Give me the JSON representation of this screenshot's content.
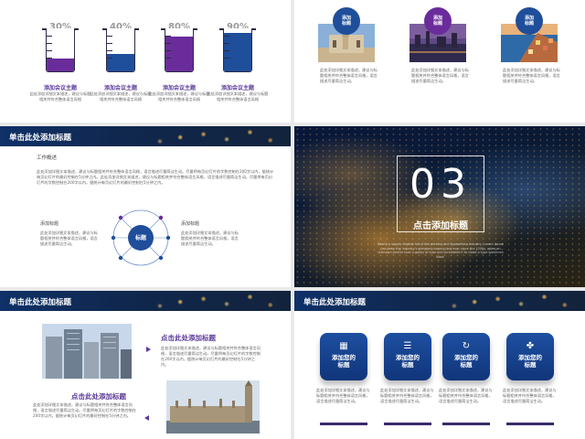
{
  "colors": {
    "navy": "#10357a",
    "purple": "#6a2c9a",
    "blue": "#1f4e9a",
    "accent": "#5b3a9a"
  },
  "slide1": {
    "beakers": [
      {
        "pct": "30%",
        "level": 0.3,
        "color": "#6a2c9a",
        "title": "添加会议主题",
        "desc": "此处添加详细文本描述，建议与标题相关并符合整体语言风格"
      },
      {
        "pct": "40%",
        "level": 0.4,
        "color": "#1f4e9a",
        "title": "添加会议主题",
        "desc": "此处添加详细文本描述，建议与标题相关并符合整体语言风格"
      },
      {
        "pct": "80%",
        "level": 0.8,
        "color": "#6a2c9a",
        "title": "添加会议主题",
        "desc": "此处添加详细文本描述，建议与标题相关并符合整体语言风格"
      },
      {
        "pct": "90%",
        "level": 0.9,
        "color": "#1f4e9a",
        "title": "添加会议主题",
        "desc": "此处添加详细文本描述，建议与标题相关并符合整体语言风格"
      }
    ]
  },
  "slide2": {
    "items": [
      {
        "label": "添加\n标题",
        "color": "#1f4e9a",
        "desc": "此处添加详细文本描述，建议与标题相关并符合整体语言风格，语言描述尽量简洁生动。"
      },
      {
        "label": "添加\n标题",
        "color": "#6a2c9a",
        "desc": "此处添加详细文本描述，建议与标题相关并符合整体语言风格，语言描述尽量简洁生动。"
      },
      {
        "label": "添加\n标题",
        "color": "#1f4e9a",
        "desc": "此处添加详细文本描述，建议与标题相关并符合整体语言风格，语言描述尽量简洁生动。"
      }
    ]
  },
  "slide3": {
    "title": "单击此处添加标题",
    "subtitle": "工作概述",
    "body": "此处添加详细文本描述，建议与标题相关并符合整体语言风格，语言描述尽量简洁生动。尽量将每页幻灯片的字数控制在200字以内，据统计每页幻灯片的最好控制在5分钟之内。此处添加详细文本描述，建议与标题相关并符合整体语言风格，语言描述尽量简洁生动。尽量将每页幻灯片的字数控制在200字以内，据统计每页幻灯片的最好控制在5分钟之内。",
    "left_label": "添加标题",
    "left_desc": "此处添加详细文本描述，建议与标题相关并符合整体语言风格，语言描述尽量简洁生动。",
    "right_label": "添加标题",
    "right_desc": "此处添加详细文本描述，建议与标题相关并符合整体语言风格，语言描述尽量简洁生动。",
    "center": "标题"
  },
  "slide4": {
    "number": "03",
    "title": "点击添加标题",
    "caption": "Nearly a supply eligible fall of the printing and typesetting industry, Lorem Ipsum has been the industry's standard dummy text ever since the 1500s, when an unknown printer took a galley of type and scrambled it to make a type specimen book."
  },
  "slide5": {
    "title": "单击此处添加标题",
    "h1": "点击此处添加标题",
    "d1": "此处添加详细文本描述，建议与标题相关并符合整体语言风格，语言描述尽量简洁生动。尽量将每页幻灯片的字数控制在200字以内，据统计每页幻灯片的最好控制在5分钟之内。",
    "h2": "点击此处添加标题",
    "d2": "此处添加详细文本描述，建议与标题相关并符合整体语言风格，语言描述尽量简洁生动。尽量将每页幻灯片的字数控制在200字以内，据统计每页幻灯片的最好控制在5分钟之内。"
  },
  "slide6": {
    "title": "单击此处添加标题",
    "cards": [
      {
        "icon": "grid-icon",
        "glyph": "▦",
        "label": "添加您的\n标题",
        "desc": "此处添加详细文本描述，建议与标题相关并符合整体语言风格，语言描述尽量简洁生动。"
      },
      {
        "icon": "database-icon",
        "glyph": "☰",
        "label": "添加您的\n标题",
        "desc": "此处添加详细文本描述，建议与标题相关并符合整体语言风格，语言描述尽量简洁生动。"
      },
      {
        "icon": "refresh-icon",
        "glyph": "↻",
        "label": "添加您的\n标题",
        "desc": "此处添加详细文本描述，建议与标题相关并符合整体语言风格，语言描述尽量简洁生动。"
      },
      {
        "icon": "clover-icon",
        "glyph": "✤",
        "label": "添加您的\n标题",
        "desc": "此处添加详细文本描述，建议与标题相关并符合整体语言风格，语言描述尽量简洁生动。"
      }
    ]
  }
}
